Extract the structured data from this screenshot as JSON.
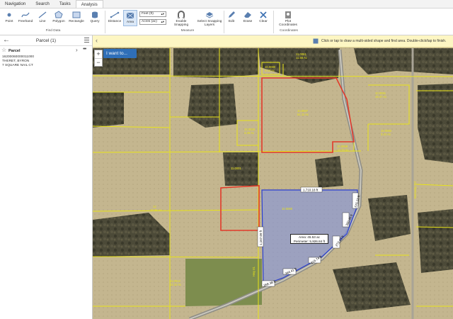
{
  "tabs": [
    "Navigation",
    "Search",
    "Tasks",
    "Analysis"
  ],
  "active_tab": "Analysis",
  "ribbon": {
    "tools": [
      {
        "label": "Point",
        "icon": "point-icon"
      },
      {
        "label": "Freehand",
        "icon": "freehand-icon"
      },
      {
        "label": "Line",
        "icon": "line-icon"
      },
      {
        "label": "Polygon",
        "icon": "polygon-icon"
      },
      {
        "label": "Rectangle",
        "icon": "rectangle-icon"
      },
      {
        "label": "Query",
        "icon": "query-icon"
      },
      {
        "label": "Distance",
        "icon": "distance-icon"
      },
      {
        "label": "Area",
        "icon": "area-icon"
      },
      {
        "label": "Enable Snapping",
        "icon": "snapping-icon"
      },
      {
        "label": "Select Snapping Layers",
        "icon": "layers-icon"
      },
      {
        "label": "Edit",
        "icon": "edit-icon"
      },
      {
        "label": "Erase",
        "icon": "erase-icon"
      },
      {
        "label": "Clear",
        "icon": "clear-icon"
      },
      {
        "label": "Plot Coordinates",
        "icon": "plot-icon"
      }
    ],
    "length_unit": "Feet (ft)",
    "area_unit": "Acres (ac)",
    "groups": {
      "find": "Find Data",
      "measure": "Measure",
      "coordinates": "Coordinates"
    }
  },
  "panel": {
    "title": "Parcel (1)",
    "record": {
      "name": "Parcel",
      "lines": [
        "16200060000011000",
        "THERET, BYRON",
        "7 SQUARE NAIL CT"
      ]
    }
  },
  "banner": {
    "text": "Click or tap to draw a multi-sided shape and find area. Double-click/tap to finish."
  },
  "map_controls": {
    "i_want": "I want to...",
    "zoom_in": "+",
    "zoom_out": "−"
  },
  "measure": {
    "area": "Area: 45.53 ac",
    "perimeter": "Perimeter: 5,926.84 ft"
  },
  "segments": [
    "1,710.18 ft",
    "1,167.09 ft",
    "576.22 ft",
    "380.48 ft",
    "272.13 ft",
    "316.74 ft",
    "344.41 ft",
    "358.38 ft"
  ],
  "map_labels": [
    "11.0061",
    "11.56 Ac",
    "10.0080",
    "9.23 Ac",
    "10.0081",
    "16.47 Ac",
    "10.0007",
    "61.11 Ac",
    "10.0034",
    "3.39 Ac",
    "10.0082",
    "3.41 Ac",
    "10.0069",
    "13.71 Ac",
    "11.0001",
    "10.0060",
    "Kentucky Rd",
    "Hwy 81",
    "12",
    "17.05 Ac",
    "11.0012",
    "12.11 Ac"
  ],
  "colors": {
    "accent": "#2f6fb8",
    "parcel_outline": "#e23a2a",
    "parcel_lines": "#e8e31a",
    "measure_fill": "#7b8fe8",
    "measure_stroke": "#2a3fd0"
  }
}
